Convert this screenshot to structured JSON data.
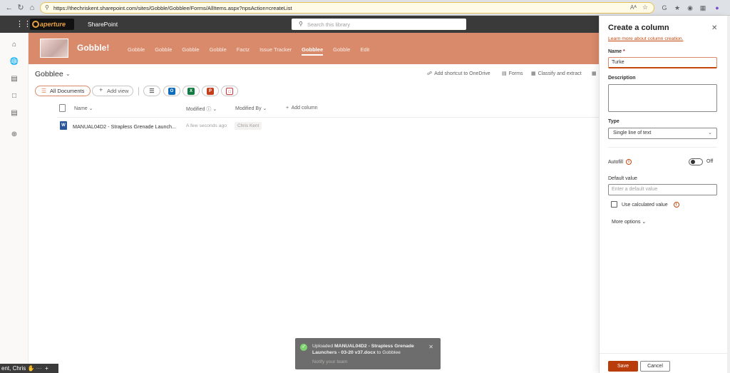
{
  "browser": {
    "url": "https://thechriskent.sharepoint.com/sites/Gobble/Gobblee/Forms/AllItems.aspx?npsAction=createList",
    "read_aloud": "Aᴬ"
  },
  "suite": {
    "logo_text": "aperture",
    "app_name": "SharePoint",
    "search_placeholder": "Search this library"
  },
  "site": {
    "title": "Gobble!",
    "nav": [
      "Gobble",
      "Gobble",
      "Gobble",
      "Gobble",
      "Factz",
      "Issue Tracker",
      "Gobblee",
      "Gobble",
      "Edit"
    ],
    "active_nav_index": 6
  },
  "library": {
    "title": "Gobblee",
    "commands": {
      "shortcut": "Add shortcut to OneDrive",
      "forms": "Forms",
      "classify": "Classify and extract"
    },
    "view_all": "All Documents",
    "add_view": "Add view",
    "columns": {
      "name": "Name",
      "modified": "Modified",
      "modified_by": "Modified By",
      "add_column": "Add column"
    },
    "rows": [
      {
        "name": "MANUAL04D2 - Strapless Grenade Launch...",
        "modified": "A few seconds ago",
        "modified_by": "Chris Kent"
      }
    ]
  },
  "toast": {
    "prefix": "Uploaded",
    "file": "MANUAL04D2 - Strapless Grenade Launchers - 03-20 v37.docx",
    "suffix": "to Gobblee",
    "action": "Notify your team"
  },
  "presence": {
    "text": "ent, Chris"
  },
  "panel": {
    "title": "Create a column",
    "learn_more": "Learn more about column creation.",
    "name_label": "Name",
    "required_mark": "*",
    "name_value": "Turke",
    "description_label": "Description",
    "type_label": "Type",
    "type_value": "Single line of text",
    "autofill_label": "Autofill",
    "autofill_state": "Off",
    "default_label": "Default value",
    "default_placeholder": "Enter a default value",
    "calculated_label": "Use calculated value",
    "more_options": "More options",
    "save": "Save",
    "cancel": "Cancel"
  },
  "colors": {
    "accent": "#d98a6a",
    "accent_dark": "#b93c0b",
    "suite_bar": "#3a3a3a"
  }
}
